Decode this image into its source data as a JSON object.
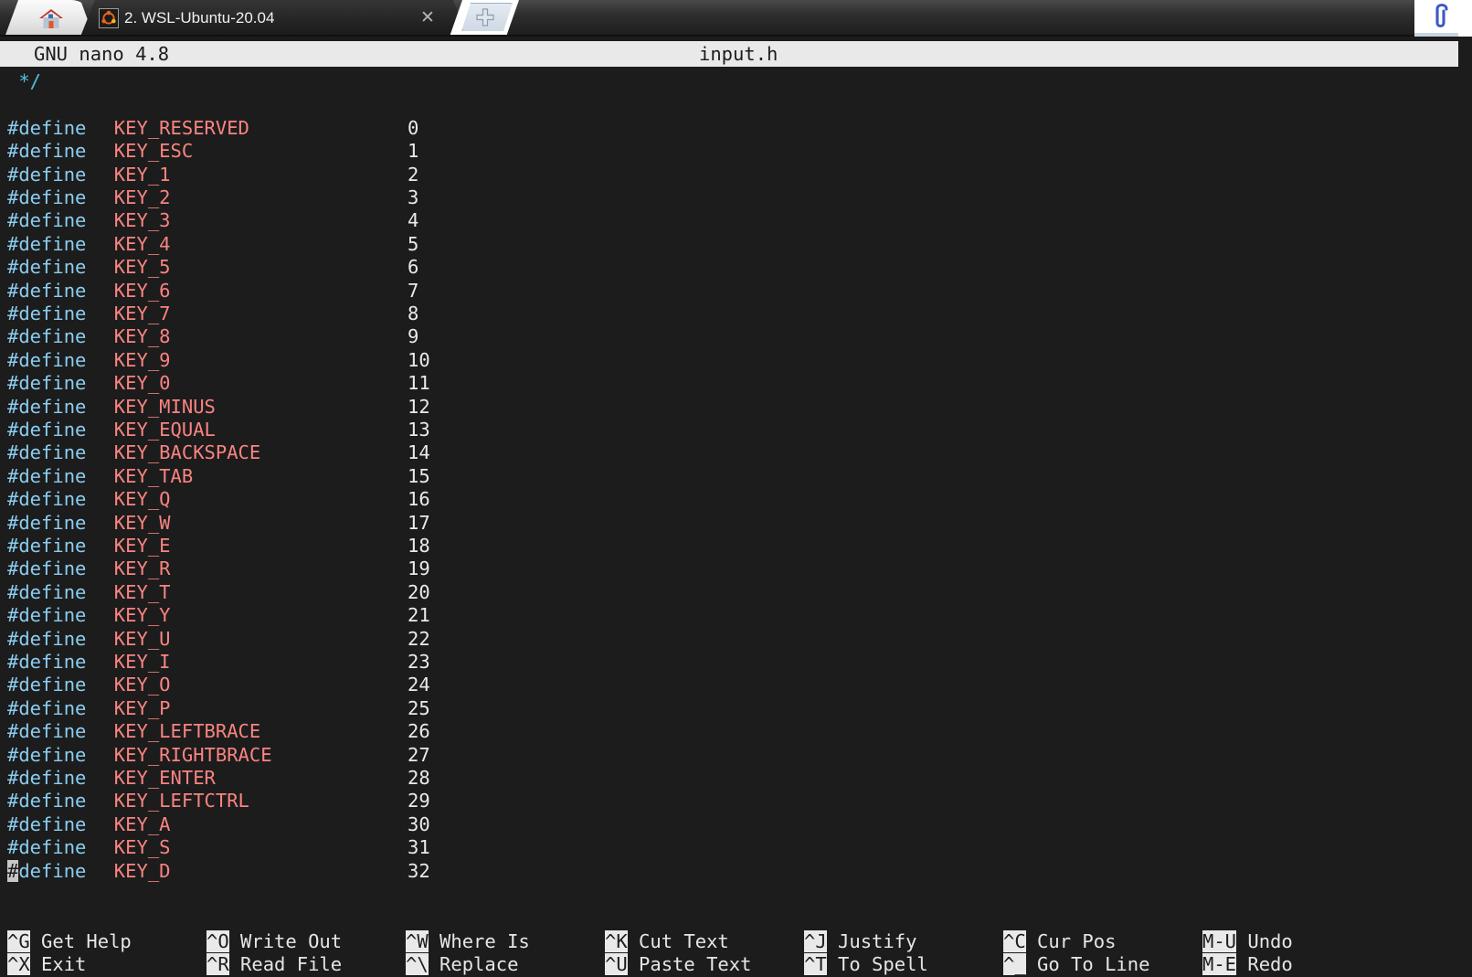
{
  "window": {
    "home_tab_icon": "home-icon",
    "attach_icon": "paperclip-icon",
    "new_tab_icon": "plus-icon",
    "close_icon": "✕",
    "tabs": [
      {
        "label": "2. WSL-Ubuntu-20.04",
        "icon": "ubuntu-logo-icon",
        "active": true
      }
    ]
  },
  "editor": {
    "version": "GNU nano 4.8",
    "filename": "input.h",
    "colors": {
      "background": "#1c1c1c",
      "titlebar_bg": "#e9e9e9",
      "directive": "#8ccdf0",
      "identifier": "#f98481",
      "number": "#eaeaea",
      "comment": "#4fc1e0",
      "cursor": "#c7c7c7"
    },
    "cursor": {
      "line": 34,
      "column": 1,
      "char": "#"
    },
    "lines": [
      {
        "comment": " */"
      },
      {
        "blank": true
      },
      {
        "directive": "#define",
        "name": "KEY_RESERVED",
        "value": "0"
      },
      {
        "directive": "#define",
        "name": "KEY_ESC",
        "value": "1"
      },
      {
        "directive": "#define",
        "name": "KEY_1",
        "value": "2"
      },
      {
        "directive": "#define",
        "name": "KEY_2",
        "value": "3"
      },
      {
        "directive": "#define",
        "name": "KEY_3",
        "value": "4"
      },
      {
        "directive": "#define",
        "name": "KEY_4",
        "value": "5"
      },
      {
        "directive": "#define",
        "name": "KEY_5",
        "value": "6"
      },
      {
        "directive": "#define",
        "name": "KEY_6",
        "value": "7"
      },
      {
        "directive": "#define",
        "name": "KEY_7",
        "value": "8"
      },
      {
        "directive": "#define",
        "name": "KEY_8",
        "value": "9"
      },
      {
        "directive": "#define",
        "name": "KEY_9",
        "value": "10"
      },
      {
        "directive": "#define",
        "name": "KEY_0",
        "value": "11"
      },
      {
        "directive": "#define",
        "name": "KEY_MINUS",
        "value": "12"
      },
      {
        "directive": "#define",
        "name": "KEY_EQUAL",
        "value": "13"
      },
      {
        "directive": "#define",
        "name": "KEY_BACKSPACE",
        "value": "14"
      },
      {
        "directive": "#define",
        "name": "KEY_TAB",
        "value": "15"
      },
      {
        "directive": "#define",
        "name": "KEY_Q",
        "value": "16"
      },
      {
        "directive": "#define",
        "name": "KEY_W",
        "value": "17"
      },
      {
        "directive": "#define",
        "name": "KEY_E",
        "value": "18"
      },
      {
        "directive": "#define",
        "name": "KEY_R",
        "value": "19"
      },
      {
        "directive": "#define",
        "name": "KEY_T",
        "value": "20"
      },
      {
        "directive": "#define",
        "name": "KEY_Y",
        "value": "21"
      },
      {
        "directive": "#define",
        "name": "KEY_U",
        "value": "22"
      },
      {
        "directive": "#define",
        "name": "KEY_I",
        "value": "23"
      },
      {
        "directive": "#define",
        "name": "KEY_O",
        "value": "24"
      },
      {
        "directive": "#define",
        "name": "KEY_P",
        "value": "25"
      },
      {
        "directive": "#define",
        "name": "KEY_LEFTBRACE",
        "value": "26"
      },
      {
        "directive": "#define",
        "name": "KEY_RIGHTBRACE",
        "value": "27"
      },
      {
        "directive": "#define",
        "name": "KEY_ENTER",
        "value": "28"
      },
      {
        "directive": "#define",
        "name": "KEY_LEFTCTRL",
        "value": "29"
      },
      {
        "directive": "#define",
        "name": "KEY_A",
        "value": "30"
      },
      {
        "directive": "#define",
        "name": "KEY_S",
        "value": "31"
      },
      {
        "directive": "#define",
        "name": "KEY_D",
        "value": "32",
        "cursor": true
      }
    ]
  },
  "shortcuts": [
    {
      "top": {
        "key": "^G",
        "label": "Get Help"
      },
      "bottom": {
        "key": "^X",
        "label": "Exit"
      }
    },
    {
      "top": {
        "key": "^O",
        "label": "Write Out"
      },
      "bottom": {
        "key": "^R",
        "label": "Read File"
      }
    },
    {
      "top": {
        "key": "^W",
        "label": "Where Is"
      },
      "bottom": {
        "key": "^\\",
        "label": "Replace"
      }
    },
    {
      "top": {
        "key": "^K",
        "label": "Cut Text"
      },
      "bottom": {
        "key": "^U",
        "label": "Paste Text"
      }
    },
    {
      "top": {
        "key": "^J",
        "label": "Justify"
      },
      "bottom": {
        "key": "^T",
        "label": "To Spell"
      }
    },
    {
      "top": {
        "key": "^C",
        "label": "Cur Pos"
      },
      "bottom": {
        "key": "^_",
        "label": "Go To Line"
      }
    },
    {
      "top": {
        "key": "M-U",
        "label": "Undo"
      },
      "bottom": {
        "key": "M-E",
        "label": "Redo"
      }
    }
  ]
}
